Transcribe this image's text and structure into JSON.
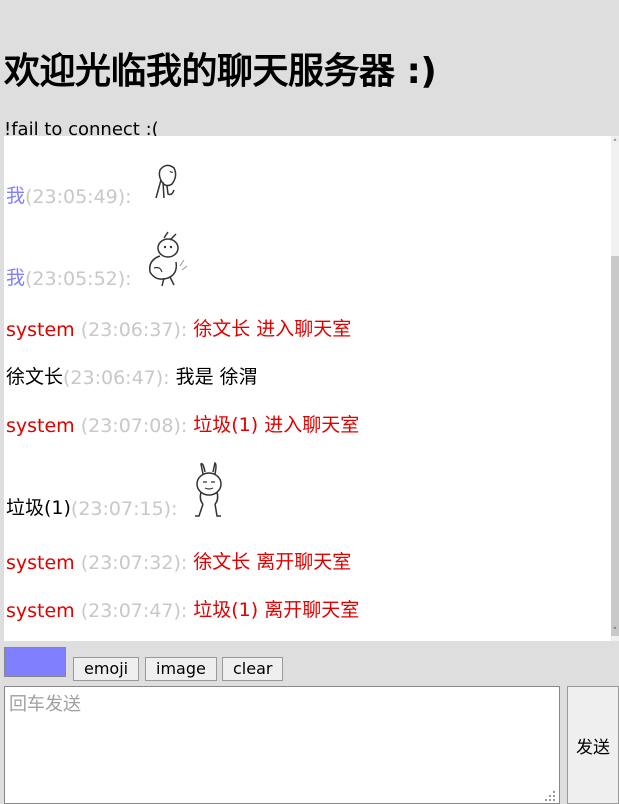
{
  "header": {
    "title": "欢迎光临我的聊天服务器 :)",
    "status": "!fail to connect :("
  },
  "messages": [
    {
      "name": "我",
      "time": "(23:05:49):",
      "type": "me",
      "text": "",
      "sticker": "sitting-figure-sticker"
    },
    {
      "name": "我",
      "time": "(23:05:52):",
      "type": "me",
      "text": "",
      "sticker": "dancing-rabbit-sticker"
    },
    {
      "name": "system",
      "time": "(23:06:37):",
      "type": "system",
      "text": "徐文长 进入聊天室",
      "sticker": ""
    },
    {
      "name": "徐文长",
      "time": "(23:06:47):",
      "type": "user",
      "text": "我是 徐渭",
      "sticker": ""
    },
    {
      "name": "system",
      "time": "(23:07:08):",
      "type": "system",
      "text": "垃圾(1) 进入聊天室",
      "sticker": ""
    },
    {
      "name": "垃圾(1)",
      "time": "(23:07:15):",
      "type": "user",
      "text": "",
      "sticker": "standing-rabbit-sticker"
    },
    {
      "name": "system",
      "time": "(23:07:32):",
      "type": "system",
      "text": "徐文长 离开聊天室",
      "sticker": ""
    },
    {
      "name": "system",
      "time": "(23:07:47):",
      "type": "system",
      "text": "垃圾(1) 离开聊天室",
      "sticker": ""
    }
  ],
  "toolbar": {
    "color": "#8080ff",
    "emoji_label": "emoji",
    "image_label": "image",
    "clear_label": "clear"
  },
  "composer": {
    "placeholder": "回车发送",
    "value": "",
    "send_label": "发送"
  }
}
